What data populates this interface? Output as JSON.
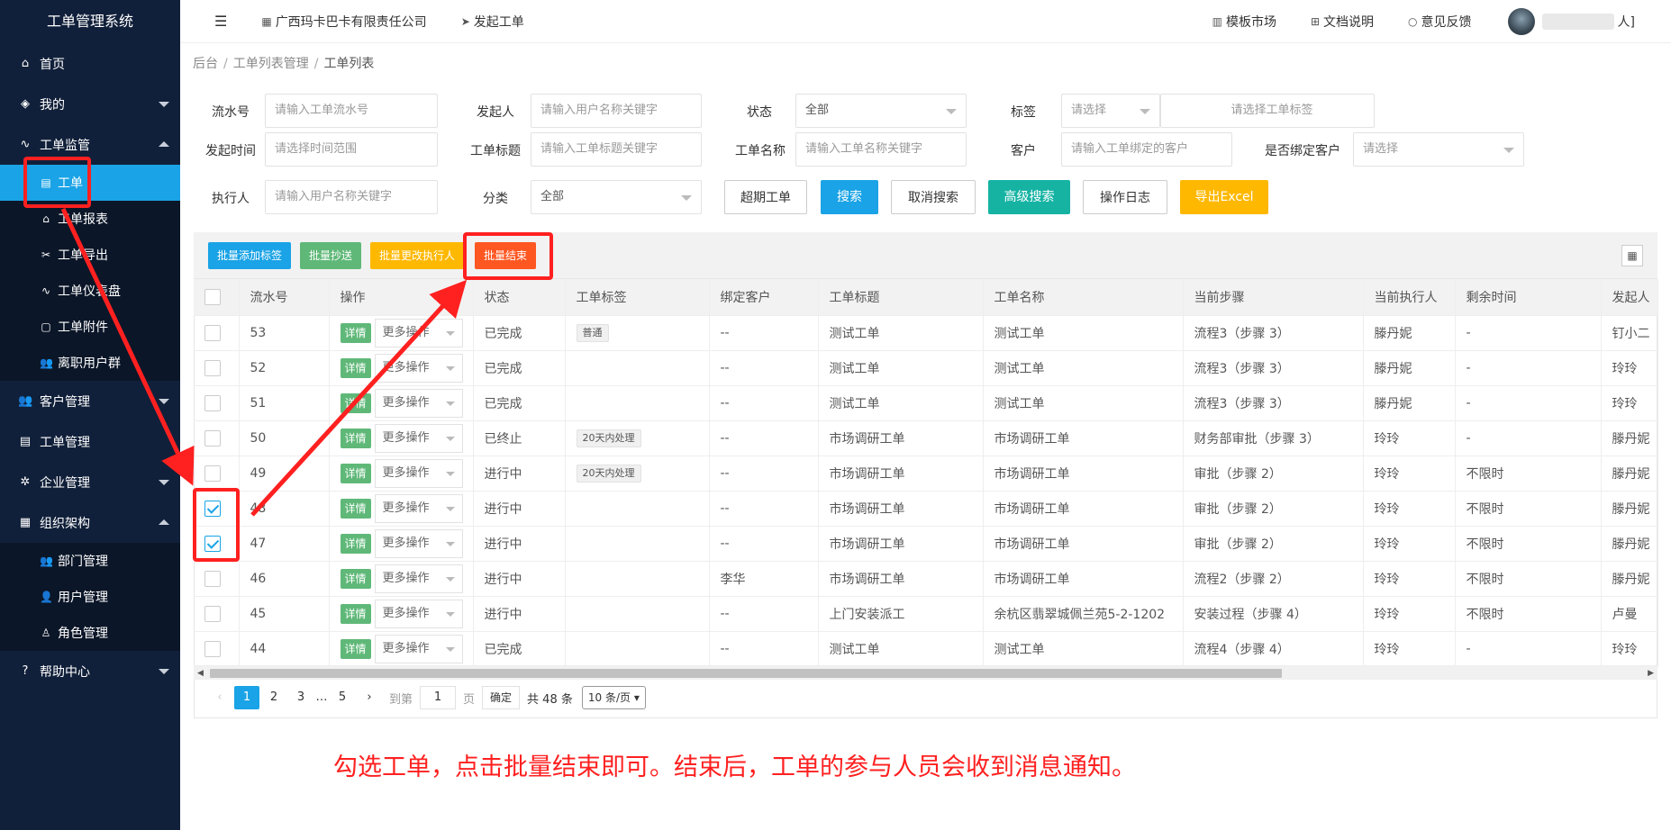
{
  "sidebar": {
    "title": "工单管理系统",
    "items": [
      {
        "label": "首页",
        "icon": "home-icon"
      },
      {
        "label": "我的",
        "icon": "layers-icon"
      },
      {
        "label": "工单监管",
        "icon": "pulse-icon"
      },
      {
        "label": "客户管理",
        "icon": "users-icon"
      },
      {
        "label": "工单管理",
        "icon": "list-icon"
      },
      {
        "label": "企业管理",
        "icon": "gear-icon"
      },
      {
        "label": "组织架构",
        "icon": "org-icon"
      },
      {
        "label": "帮助中心",
        "icon": "help-icon"
      }
    ],
    "monitor_sub": [
      {
        "label": "工单",
        "icon": "doc-icon"
      },
      {
        "label": "工单报表",
        "icon": "home-icon"
      },
      {
        "label": "工单导出",
        "icon": "export-icon"
      },
      {
        "label": "工单仪表盘",
        "icon": "pulse-icon"
      },
      {
        "label": "工单附件",
        "icon": "file-icon"
      },
      {
        "label": "离职用户群",
        "icon": "users-icon"
      }
    ],
    "org_sub": [
      {
        "label": "部门管理",
        "icon": "users-icon"
      },
      {
        "label": "用户管理",
        "icon": "user-icon"
      },
      {
        "label": "角色管理",
        "icon": "user-outline-icon"
      }
    ]
  },
  "topbar": {
    "company": "广西玛卡巴卡有限责任公司",
    "create": "发起工单",
    "template_market": "模板市场",
    "docs": "文档说明",
    "feedback": "意见反馈",
    "user_suffix": "人]"
  },
  "breadcrumb": [
    "后台",
    "工单列表管理",
    "工单列表"
  ],
  "filters": {
    "serial_label": "流水号",
    "serial_ph": "请输入工单流水号",
    "initiator_label": "发起人",
    "initiator_ph": "请输入用户名称关键字",
    "status_label": "状态",
    "status_value": "全部",
    "tag_label": "标签",
    "tag_select": "请选择",
    "tag_ph": "请选择工单标签",
    "time_label": "发起时间",
    "time_ph": "请选择时间范围",
    "title_label": "工单标题",
    "title_ph": "请输入工单标题关键字",
    "name_label": "工单名称",
    "name_ph": "请输入工单名称关键字",
    "customer_label": "客户",
    "customer_ph": "请输入工单绑定的客户",
    "bind_label": "是否绑定客户",
    "bind_value": "请选择",
    "executor_label": "执行人",
    "executor_ph": "请输入用户名称关键字",
    "category_label": "分类",
    "category_value": "全部",
    "btn_overdue": "超期工单",
    "btn_search": "搜索",
    "btn_cancel": "取消搜索",
    "btn_advanced": "高级搜索",
    "btn_log": "操作日志",
    "btn_export": "导出Excel"
  },
  "toolbar": {
    "add_tag": "批量添加标签",
    "cc": "批量抄送",
    "change_exec": "批量更改执行人",
    "finish": "批量结束"
  },
  "table": {
    "headers": [
      "流水号",
      "操作",
      "状态",
      "工单标签",
      "绑定客户",
      "工单标题",
      "工单名称",
      "当前步骤",
      "当前执行人",
      "剩余时间",
      "发起人"
    ],
    "detail_label": "详情",
    "more_label": "更多操作",
    "rows": [
      {
        "id": "53",
        "checked": false,
        "status": "已完成",
        "status_type": "done",
        "tag": "普通",
        "customer": "--",
        "title": "测试工单",
        "name": "测试工单",
        "step": "流程3（步骤 3）",
        "executor": "滕丹妮",
        "remain": "-",
        "initiator": "钉小二"
      },
      {
        "id": "52",
        "checked": false,
        "status": "已完成",
        "status_type": "done",
        "tag": "",
        "customer": "--",
        "title": "测试工单",
        "name": "测试工单",
        "step": "流程3（步骤 3）",
        "executor": "滕丹妮",
        "remain": "-",
        "initiator": "玲玲"
      },
      {
        "id": "51",
        "checked": false,
        "status": "已完成",
        "status_type": "done",
        "tag": "",
        "customer": "--",
        "title": "测试工单",
        "name": "测试工单",
        "step": "流程3（步骤 3）",
        "executor": "滕丹妮",
        "remain": "-",
        "initiator": "玲玲"
      },
      {
        "id": "50",
        "checked": false,
        "status": "已终止",
        "status_type": "stop",
        "tag": "20天内处理",
        "customer": "--",
        "title": "市场调研工单",
        "name": "市场调研工单",
        "step": "财务部审批（步骤 3）",
        "executor": "玲玲",
        "remain": "-",
        "initiator": "滕丹妮"
      },
      {
        "id": "49",
        "checked": false,
        "status": "进行中",
        "status_type": "run",
        "tag": "20天内处理",
        "customer": "--",
        "title": "市场调研工单",
        "name": "市场调研工单",
        "step": "审批（步骤 2）",
        "executor": "玲玲",
        "remain": "不限时",
        "initiator": "滕丹妮"
      },
      {
        "id": "48",
        "checked": true,
        "status": "进行中",
        "status_type": "run",
        "tag": "",
        "customer": "--",
        "title": "市场调研工单",
        "name": "市场调研工单",
        "step": "审批（步骤 2）",
        "executor": "玲玲",
        "remain": "不限时",
        "initiator": "滕丹妮"
      },
      {
        "id": "47",
        "checked": true,
        "status": "进行中",
        "status_type": "run",
        "tag": "",
        "customer": "--",
        "title": "市场调研工单",
        "name": "市场调研工单",
        "step": "审批（步骤 2）",
        "executor": "玲玲",
        "remain": "不限时",
        "initiator": "滕丹妮"
      },
      {
        "id": "46",
        "checked": false,
        "status": "进行中",
        "status_type": "run",
        "tag": "",
        "customer": "李华",
        "title": "市场调研工单",
        "name": "市场调研工单",
        "step": "流程2（步骤 2）",
        "executor": "玲玲",
        "remain": "不限时",
        "initiator": "滕丹妮"
      },
      {
        "id": "45",
        "checked": false,
        "status": "进行中",
        "status_type": "run",
        "tag": "",
        "customer": "--",
        "title": "上门安装派工",
        "name": "余杭区翡翠城佩兰苑5-2-1202",
        "step": "安装过程（步骤 4）",
        "executor": "玲玲",
        "remain": "不限时",
        "initiator": "卢曼"
      },
      {
        "id": "44",
        "checked": false,
        "status": "已完成",
        "status_type": "done",
        "tag": "",
        "customer": "--",
        "title": "测试工单",
        "name": "测试工单",
        "step": "流程4（步骤 4）",
        "executor": "玲玲",
        "remain": "-",
        "initiator": "玲玲"
      }
    ]
  },
  "pager": {
    "pages": [
      "1",
      "2",
      "3",
      "…",
      "5"
    ],
    "goto": "到第",
    "current": "1",
    "page_unit": "页",
    "confirm": "确定",
    "total": "共 48 条",
    "size": "10 条/页"
  },
  "annotation": "勾选工单，点击批量结束即可。结束后，工单的参与人员会收到消息通知。",
  "colors": {
    "sidebar": "#11203a",
    "active": "#1aa3e6",
    "highlight": "#ff2020"
  }
}
